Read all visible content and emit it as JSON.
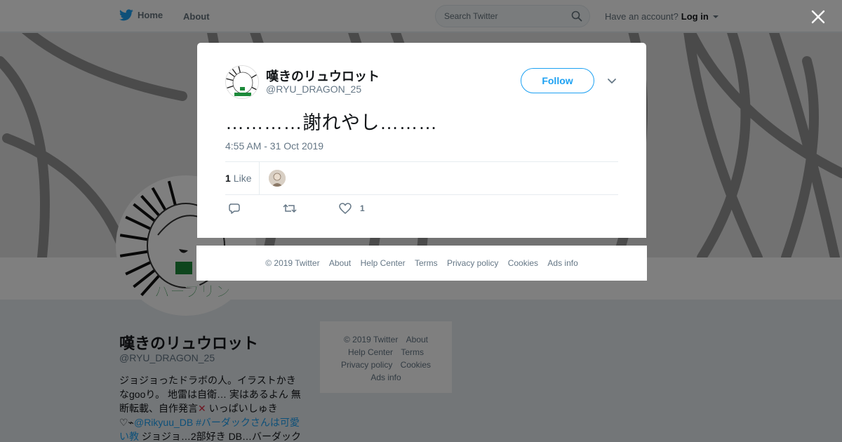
{
  "topbar": {
    "home_label": "Home",
    "about_label": "About",
    "search_placeholder": "Search Twitter",
    "account_text": "Have an account?",
    "login_label": "Log in"
  },
  "profile": {
    "name": "嘆きのリュウロット",
    "handle": "@RYU_DRAGON_25",
    "bio_part1": "ジョジョったドラボの人。イラストかきなgooり。 地雷は自衛… 実はあるよん 無断転載、自作発言",
    "bio_part2": " いっぱいしゅき♡⌁",
    "bio_link1": "@Rikyuu_DB",
    "bio_link2": "#バーダックさんは可愛い教",
    "bio_part3": " ジョジョ…2部好き DB…バーダック"
  },
  "side_footer": {
    "links": [
      "© 2019 Twitter",
      "About",
      "Help Center",
      "Terms",
      "Privacy policy",
      "Cookies",
      "Ads info"
    ]
  },
  "modal": {
    "name": "嘆きのリュウロット",
    "handle": "@RYU_DRAGON_25",
    "follow_label": "Follow",
    "tweet_text": "…………謝れやし………",
    "timestamp": "4:55 AM - 31 Oct 2019",
    "like_count": "1",
    "like_label": "Like",
    "action_like_count": "1"
  },
  "modal_footer": {
    "links": [
      "© 2019 Twitter",
      "About",
      "Help Center",
      "Terms",
      "Privacy policy",
      "Cookies",
      "Ads info"
    ]
  },
  "colors": {
    "accent": "#1da1f2",
    "text_secondary": "#657786"
  }
}
